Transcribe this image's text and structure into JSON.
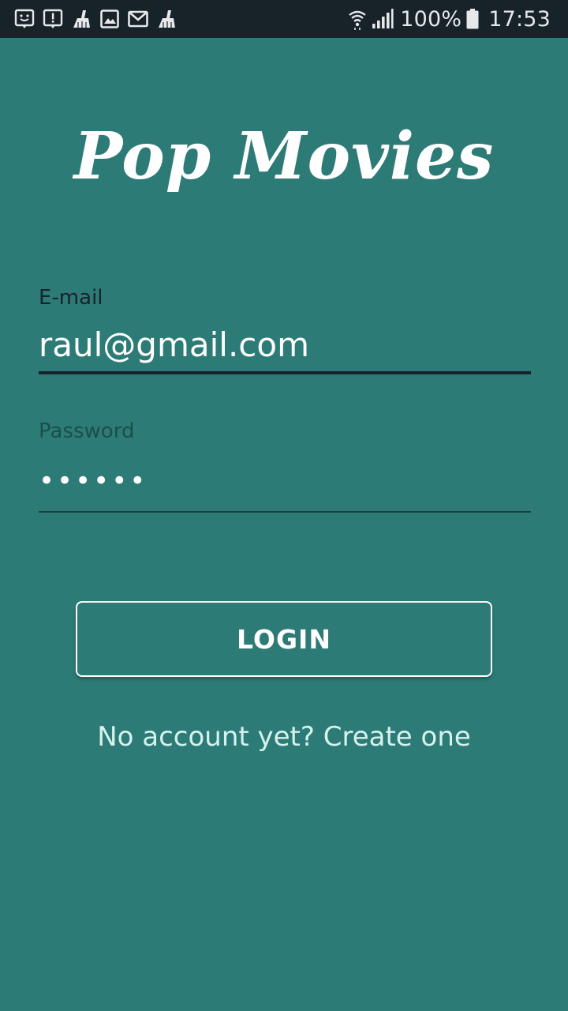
{
  "status_bar": {
    "battery_percent": "100%",
    "time": "17:53",
    "icons_left": [
      "feedback-icon",
      "alert-icon",
      "cleaner-icon",
      "gallery-icon",
      "gmail-icon",
      "cleaner-icon"
    ],
    "icons_right": [
      "wifi-icon",
      "signal-icon",
      "battery-icon"
    ]
  },
  "app": {
    "title": "Pop Movies"
  },
  "login_form": {
    "email_label": "E-mail",
    "email_value": "raul@gmail.com",
    "password_label": "Password",
    "password_value": "••••••",
    "login_button_label": "LOGIN",
    "register_link_text": "No account yet? Create one"
  },
  "colors": {
    "background": "#2d7b77",
    "status_bar": "#182229",
    "accent_underline": "#17232a"
  }
}
